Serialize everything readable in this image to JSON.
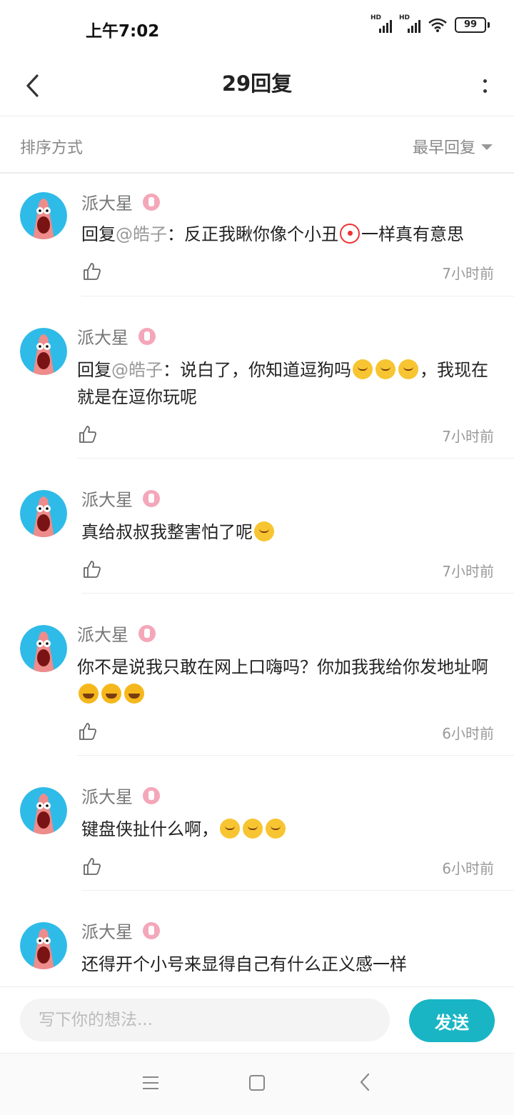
{
  "status_bar": {
    "time": "上午7:02",
    "hd1": "HD",
    "hd2": "HD",
    "battery": "99"
  },
  "header": {
    "title": "29回复",
    "back_icon": "chevron-left-icon",
    "more_icon": "more-vertical-icon"
  },
  "sort": {
    "label": "排序方式",
    "selected": "最早回复"
  },
  "replies": [
    {
      "name": "派大星",
      "prefix": "回复",
      "mention": "@皓子",
      "body": "：反正我瞅你像个小丑",
      "emoji": "clown",
      "suffix": "一样真有意思",
      "time": "7小时前"
    },
    {
      "name": "派大星",
      "prefix": "回复",
      "mention": "@皓子",
      "body": "：说白了，你知道逗狗吗",
      "emoji": "hug×3",
      "suffix": "，我现在就是在逗你玩呢",
      "time": "7小时前"
    },
    {
      "name": "派大星",
      "body": "真给叔叔我整害怕了呢",
      "emoji": "hug",
      "time": "7小时前"
    },
    {
      "name": "派大星",
      "body": "你不是说我只敢在网上口嗨吗？你加我我给你发地址啊",
      "emoji": "rofl×3",
      "time": "6小时前"
    },
    {
      "name": "派大星",
      "body": "键盘侠扯什么啊，",
      "emoji": "hug×3",
      "time": "6小时前"
    },
    {
      "name": "派大星",
      "body": "还得开个小号来显得自己有什么正义感一样"
    }
  ],
  "composer": {
    "placeholder": "写下你的想法...",
    "send_label": "发送"
  },
  "colors": {
    "accent": "#19b5c5",
    "mention": "#999999",
    "badge": "#f4a7b9"
  }
}
